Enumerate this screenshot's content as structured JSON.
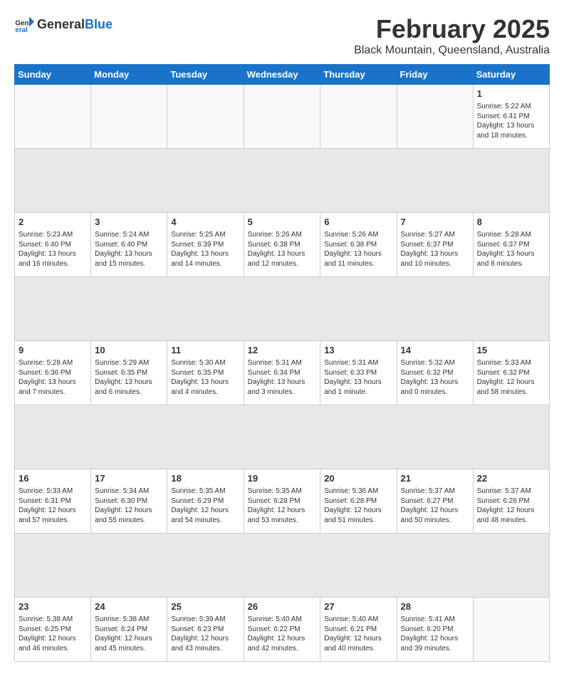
{
  "logo": {
    "general": "General",
    "blue": "Blue"
  },
  "title": "February 2025",
  "subtitle": "Black Mountain, Queensland, Australia",
  "days_header": [
    "Sunday",
    "Monday",
    "Tuesday",
    "Wednesday",
    "Thursday",
    "Friday",
    "Saturday"
  ],
  "weeks": [
    [
      {
        "day": "",
        "info": ""
      },
      {
        "day": "",
        "info": ""
      },
      {
        "day": "",
        "info": ""
      },
      {
        "day": "",
        "info": ""
      },
      {
        "day": "",
        "info": ""
      },
      {
        "day": "",
        "info": ""
      },
      {
        "day": "1",
        "info": "Sunrise: 5:22 AM\nSunset: 6:41 PM\nDaylight: 13 hours and 18 minutes."
      }
    ],
    [
      {
        "day": "2",
        "info": "Sunrise: 5:23 AM\nSunset: 6:40 PM\nDaylight: 13 hours and 16 minutes."
      },
      {
        "day": "3",
        "info": "Sunrise: 5:24 AM\nSunset: 6:40 PM\nDaylight: 13 hours and 15 minutes."
      },
      {
        "day": "4",
        "info": "Sunrise: 5:25 AM\nSunset: 6:39 PM\nDaylight: 13 hours and 14 minutes."
      },
      {
        "day": "5",
        "info": "Sunrise: 5:26 AM\nSunset: 6:38 PM\nDaylight: 13 hours and 12 minutes."
      },
      {
        "day": "6",
        "info": "Sunrise: 5:26 AM\nSunset: 6:38 PM\nDaylight: 13 hours and 11 minutes."
      },
      {
        "day": "7",
        "info": "Sunrise: 5:27 AM\nSunset: 6:37 PM\nDaylight: 13 hours and 10 minutes."
      },
      {
        "day": "8",
        "info": "Sunrise: 5:28 AM\nSunset: 6:37 PM\nDaylight: 13 hours and 8 minutes."
      }
    ],
    [
      {
        "day": "9",
        "info": "Sunrise: 5:28 AM\nSunset: 6:36 PM\nDaylight: 13 hours and 7 minutes."
      },
      {
        "day": "10",
        "info": "Sunrise: 5:29 AM\nSunset: 6:35 PM\nDaylight: 13 hours and 6 minutes."
      },
      {
        "day": "11",
        "info": "Sunrise: 5:30 AM\nSunset: 6:35 PM\nDaylight: 13 hours and 4 minutes."
      },
      {
        "day": "12",
        "info": "Sunrise: 5:31 AM\nSunset: 6:34 PM\nDaylight: 13 hours and 3 minutes."
      },
      {
        "day": "13",
        "info": "Sunrise: 5:31 AM\nSunset: 6:33 PM\nDaylight: 13 hours and 1 minute."
      },
      {
        "day": "14",
        "info": "Sunrise: 5:32 AM\nSunset: 6:32 PM\nDaylight: 13 hours and 0 minutes."
      },
      {
        "day": "15",
        "info": "Sunrise: 5:33 AM\nSunset: 6:32 PM\nDaylight: 12 hours and 58 minutes."
      }
    ],
    [
      {
        "day": "16",
        "info": "Sunrise: 5:33 AM\nSunset: 6:31 PM\nDaylight: 12 hours and 57 minutes."
      },
      {
        "day": "17",
        "info": "Sunrise: 5:34 AM\nSunset: 6:30 PM\nDaylight: 12 hours and 55 minutes."
      },
      {
        "day": "18",
        "info": "Sunrise: 5:35 AM\nSunset: 6:29 PM\nDaylight: 12 hours and 54 minutes."
      },
      {
        "day": "19",
        "info": "Sunrise: 5:35 AM\nSunset: 6:28 PM\nDaylight: 12 hours and 53 minutes."
      },
      {
        "day": "20",
        "info": "Sunrise: 5:36 AM\nSunset: 6:28 PM\nDaylight: 12 hours and 51 minutes."
      },
      {
        "day": "21",
        "info": "Sunrise: 5:37 AM\nSunset: 6:27 PM\nDaylight: 12 hours and 50 minutes."
      },
      {
        "day": "22",
        "info": "Sunrise: 5:37 AM\nSunset: 6:26 PM\nDaylight: 12 hours and 48 minutes."
      }
    ],
    [
      {
        "day": "23",
        "info": "Sunrise: 5:38 AM\nSunset: 6:25 PM\nDaylight: 12 hours and 46 minutes."
      },
      {
        "day": "24",
        "info": "Sunrise: 5:38 AM\nSunset: 6:24 PM\nDaylight: 12 hours and 45 minutes."
      },
      {
        "day": "25",
        "info": "Sunrise: 5:39 AM\nSunset: 6:23 PM\nDaylight: 12 hours and 43 minutes."
      },
      {
        "day": "26",
        "info": "Sunrise: 5:40 AM\nSunset: 6:22 PM\nDaylight: 12 hours and 42 minutes."
      },
      {
        "day": "27",
        "info": "Sunrise: 5:40 AM\nSunset: 6:21 PM\nDaylight: 12 hours and 40 minutes."
      },
      {
        "day": "28",
        "info": "Sunrise: 5:41 AM\nSunset: 6:20 PM\nDaylight: 12 hours and 39 minutes."
      },
      {
        "day": "",
        "info": ""
      }
    ]
  ]
}
